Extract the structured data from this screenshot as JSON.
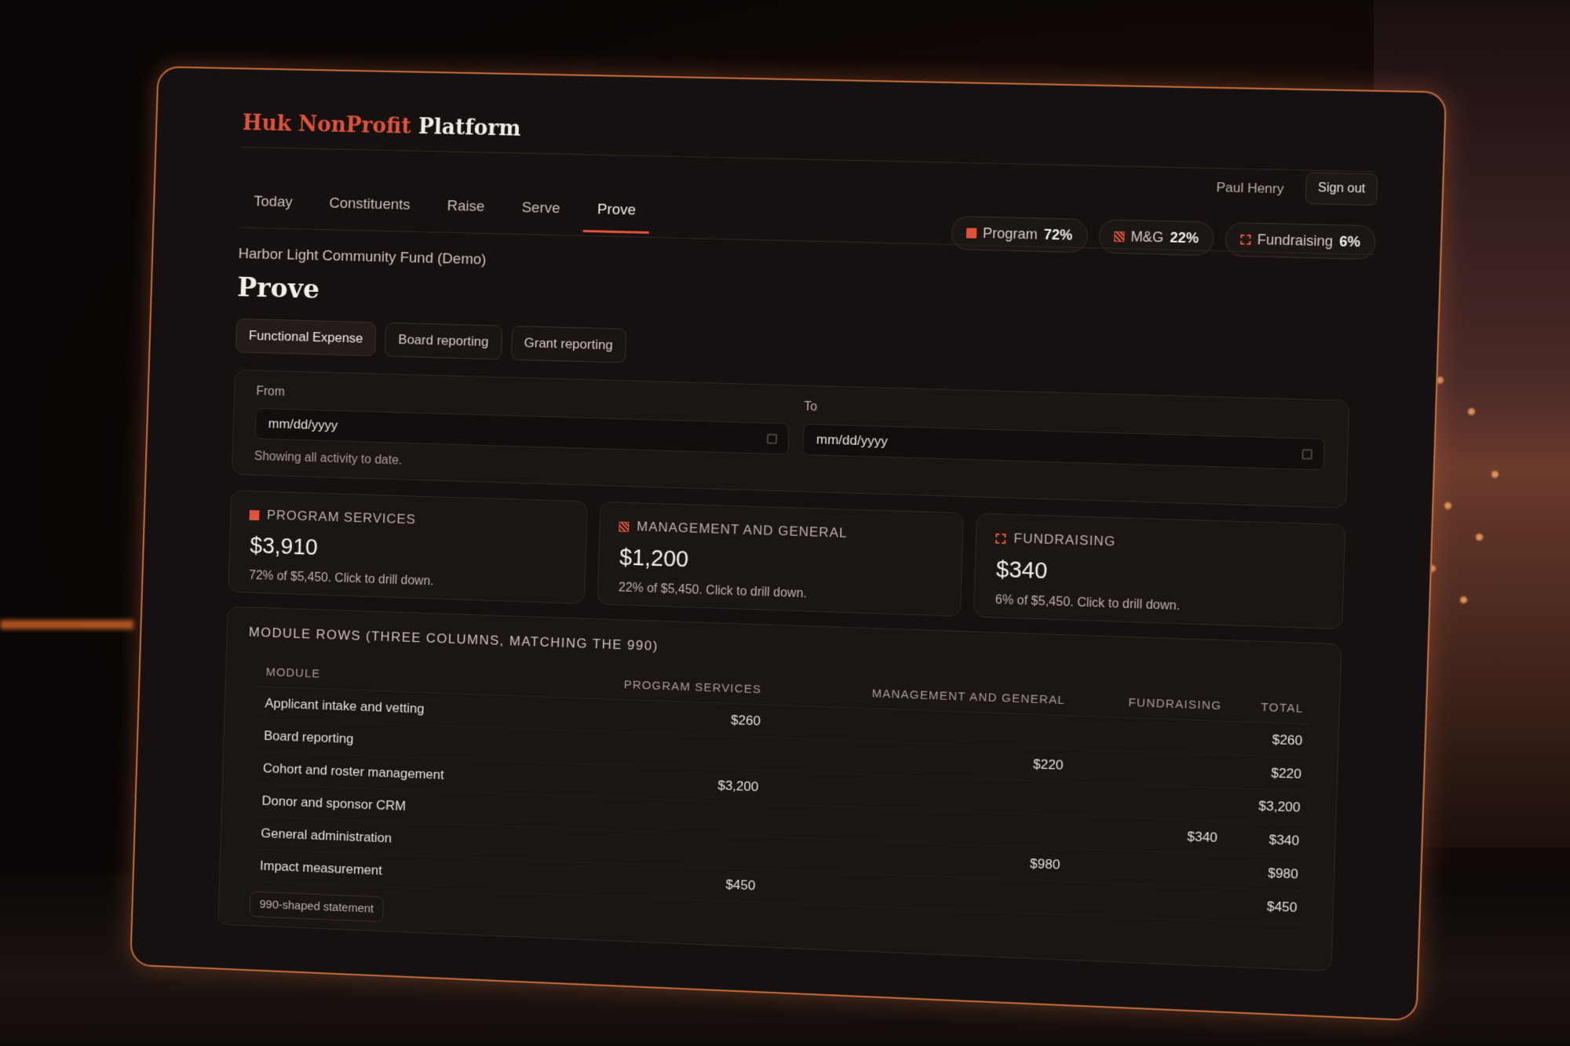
{
  "brand": {
    "part1": "Huk NonProfit",
    "part2": "Platform"
  },
  "user": {
    "name": "Paul Henry",
    "signout_label": "Sign out"
  },
  "nav": {
    "tabs": [
      "Today",
      "Constituents",
      "Raise",
      "Serve",
      "Prove"
    ],
    "active": "Prove"
  },
  "split_pills": [
    {
      "label": "Program",
      "value": "72%"
    },
    {
      "label": "M&G",
      "value": "22%"
    },
    {
      "label": "Fundraising",
      "value": "6%"
    }
  ],
  "org_name": "Harbor Light Community Fund (Demo)",
  "page_title": "Prove",
  "subtabs": [
    "Functional Expense",
    "Board reporting",
    "Grant reporting"
  ],
  "date_filter": {
    "from_label": "From",
    "from_placeholder": "mm/dd/yyyy",
    "to_label": "To",
    "to_placeholder": "mm/dd/yyyy",
    "hint": "Showing all activity to date."
  },
  "stats": [
    {
      "label": "PROGRAM SERVICES",
      "value": "$3,910",
      "sub": "72% of $5,450. Click to drill down."
    },
    {
      "label": "MANAGEMENT AND GENERAL",
      "value": "$1,200",
      "sub": "22% of $5,450. Click to drill down."
    },
    {
      "label": "FUNDRAISING",
      "value": "$340",
      "sub": "6% of $5,450. Click to drill down."
    }
  ],
  "modules": {
    "title": "MODULE ROWS (THREE COLUMNS, MATCHING THE 990)",
    "columns": [
      "MODULE",
      "PROGRAM SERVICES",
      "MANAGEMENT AND GENERAL",
      "FUNDRAISING",
      "TOTAL"
    ],
    "rows": [
      [
        "Applicant intake and vetting",
        "$260",
        "",
        "",
        "$260"
      ],
      [
        "Board reporting",
        "",
        "$220",
        "",
        "$220"
      ],
      [
        "Cohort and roster management",
        "$3,200",
        "",
        "",
        "$3,200"
      ],
      [
        "Donor and sponsor CRM",
        "",
        "",
        "$340",
        "$340"
      ],
      [
        "General administration",
        "",
        "$980",
        "",
        "$980"
      ],
      [
        "Impact measurement",
        "$450",
        "",
        "",
        "$450"
      ]
    ],
    "footer_tag": "990-shaped statement"
  },
  "colors": {
    "accent": "#e0533a",
    "panel_border": "#c26a3a",
    "background": "#161110"
  }
}
